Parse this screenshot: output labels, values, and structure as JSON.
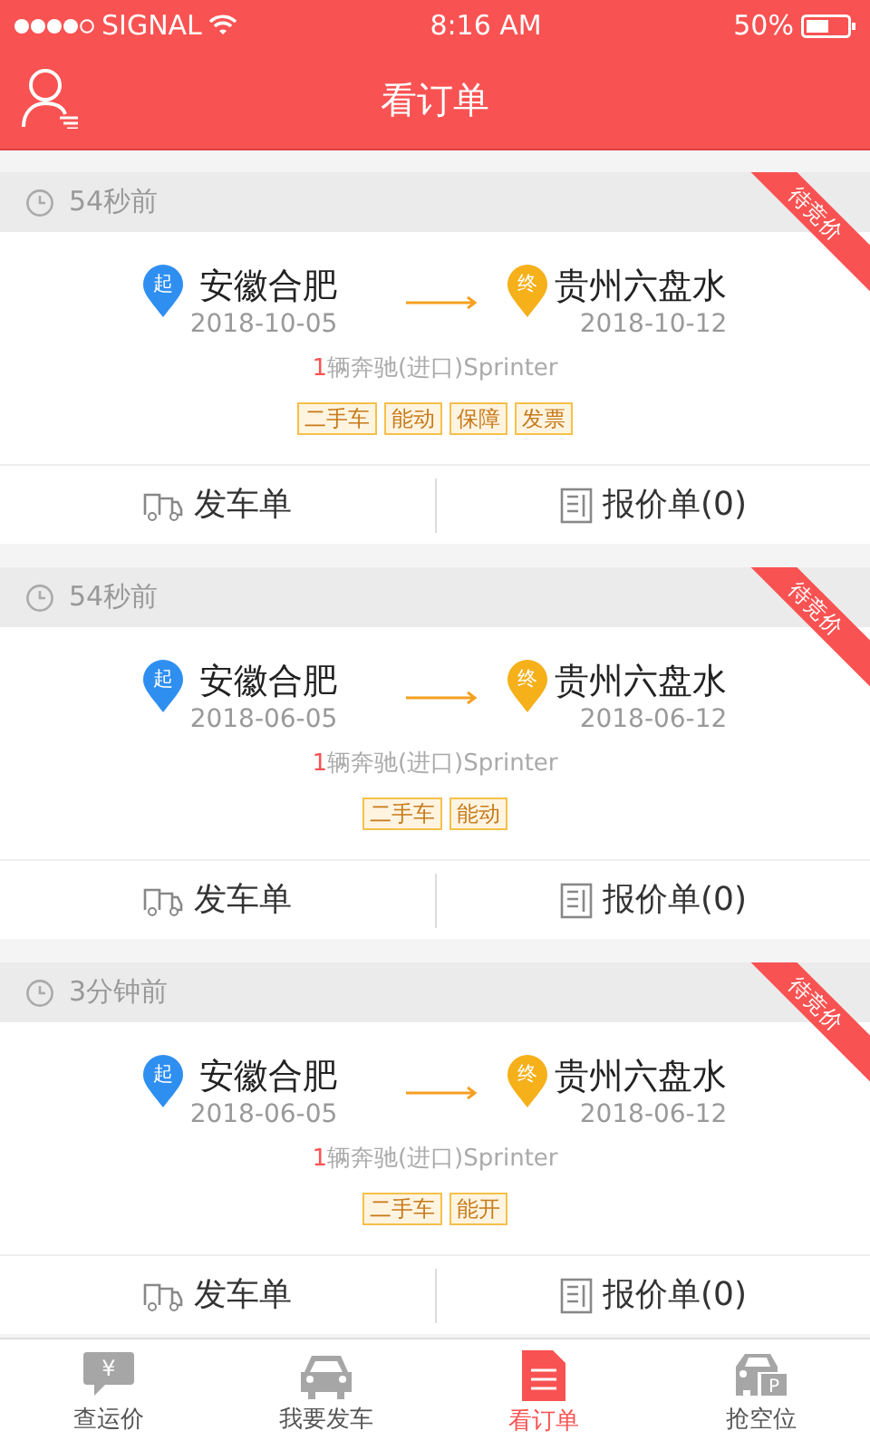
{
  "status_bar": {
    "carrier": "SIGNAL",
    "time": "8:16 AM",
    "battery": "50%"
  },
  "header": {
    "title": "看订单"
  },
  "orders": [
    {
      "time": "54秒前",
      "ribbon": "待竞价",
      "origin": {
        "marker": "起",
        "city": "安徽合肥",
        "date": "2018-10-05"
      },
      "destination": {
        "marker": "终",
        "city": "贵州六盘水",
        "date": "2018-10-12"
      },
      "vehicle_count": "1",
      "vehicle": "辆奔驰(进口)Sprinter",
      "tags": [
        "二手车",
        "能动",
        "保障",
        "发票"
      ],
      "actions": [
        "发车单",
        "报价单(0)"
      ]
    },
    {
      "time": "54秒前",
      "ribbon": "待竞价",
      "origin": {
        "marker": "起",
        "city": "安徽合肥",
        "date": "2018-06-05"
      },
      "destination": {
        "marker": "终",
        "city": "贵州六盘水",
        "date": "2018-06-12"
      },
      "vehicle_count": "1",
      "vehicle": "辆奔驰(进口)Sprinter",
      "tags": [
        "二手车",
        "能动"
      ],
      "actions": [
        "发车单",
        "报价单(0)"
      ]
    },
    {
      "time": "3分钟前",
      "ribbon": "待竞价",
      "origin": {
        "marker": "起",
        "city": "安徽合肥",
        "date": "2018-06-05"
      },
      "destination": {
        "marker": "终",
        "city": "贵州六盘水",
        "date": "2018-06-12"
      },
      "vehicle_count": "1",
      "vehicle": "辆奔驰(进口)Sprinter",
      "tags": [
        "二手车",
        "能开"
      ],
      "actions": [
        "发车单",
        "报价单(0)"
      ]
    }
  ],
  "tab_bar": [
    {
      "kind": "price",
      "label": "查运价",
      "glyph": "¥",
      "selected": false
    },
    {
      "kind": "car",
      "label": "我要发车",
      "selected": false
    },
    {
      "kind": "orders",
      "label": "看订单",
      "selected": true
    },
    {
      "kind": "parking",
      "label": "抢空位",
      "glyph": "P",
      "selected": false
    }
  ]
}
